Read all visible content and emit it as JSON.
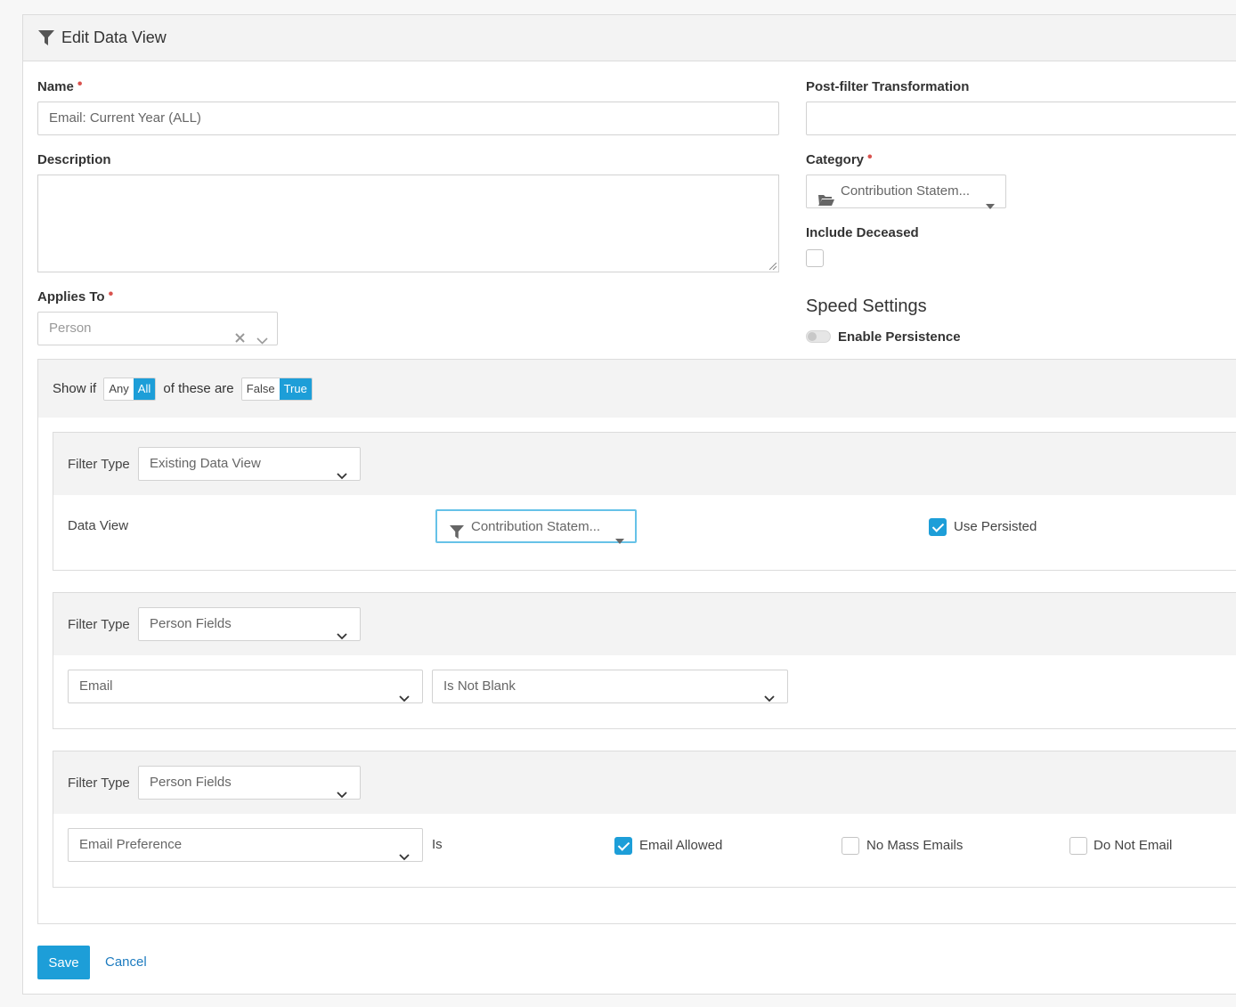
{
  "header": {
    "title": "Edit Data View",
    "icon": "filter-icon"
  },
  "form": {
    "name_label": "Name",
    "name_value": "Email: Current Year (ALL)",
    "description_label": "Description",
    "description_value": "",
    "applies_to_label": "Applies To",
    "applies_to_value": "Person",
    "post_filter_label": "Post-filter Transformation",
    "post_filter_value": "",
    "category_label": "Category",
    "category_value": "Contribution Statem...",
    "include_deceased_label": "Include Deceased",
    "include_deceased_checked": false,
    "speed_settings_heading": "Speed Settings",
    "enable_persistence_label": "Enable Persistence",
    "enable_persistence_on": false
  },
  "filter_group": {
    "show_if_label": "Show if",
    "any_label": "Any",
    "all_label": "All",
    "of_these_are_label": "of these are",
    "false_label": "False",
    "true_label": "True",
    "selected_mode": "All",
    "selected_truth": "True"
  },
  "filters": [
    {
      "filter_type_label": "Filter Type",
      "filter_type_value": "Existing Data View",
      "data_view_label": "Data View",
      "data_view_value": "Contribution Statem...",
      "use_persisted_label": "Use Persisted",
      "use_persisted_checked": true
    },
    {
      "filter_type_label": "Filter Type",
      "filter_type_value": "Person Fields",
      "field_value": "Email",
      "comparison_value": "Is Not Blank"
    },
    {
      "filter_type_label": "Filter Type",
      "filter_type_value": "Person Fields",
      "field_value": "Email Preference",
      "is_label": "Is",
      "options": [
        {
          "label": "Email Allowed",
          "checked": true
        },
        {
          "label": "No Mass Emails",
          "checked": false
        },
        {
          "label": "Do Not Email",
          "checked": false
        }
      ]
    }
  ],
  "actions": {
    "save_label": "Save",
    "cancel_label": "Cancel"
  },
  "colors": {
    "accent": "#1d9ed8",
    "required": "#d9534f",
    "link": "#1d7bbf"
  }
}
